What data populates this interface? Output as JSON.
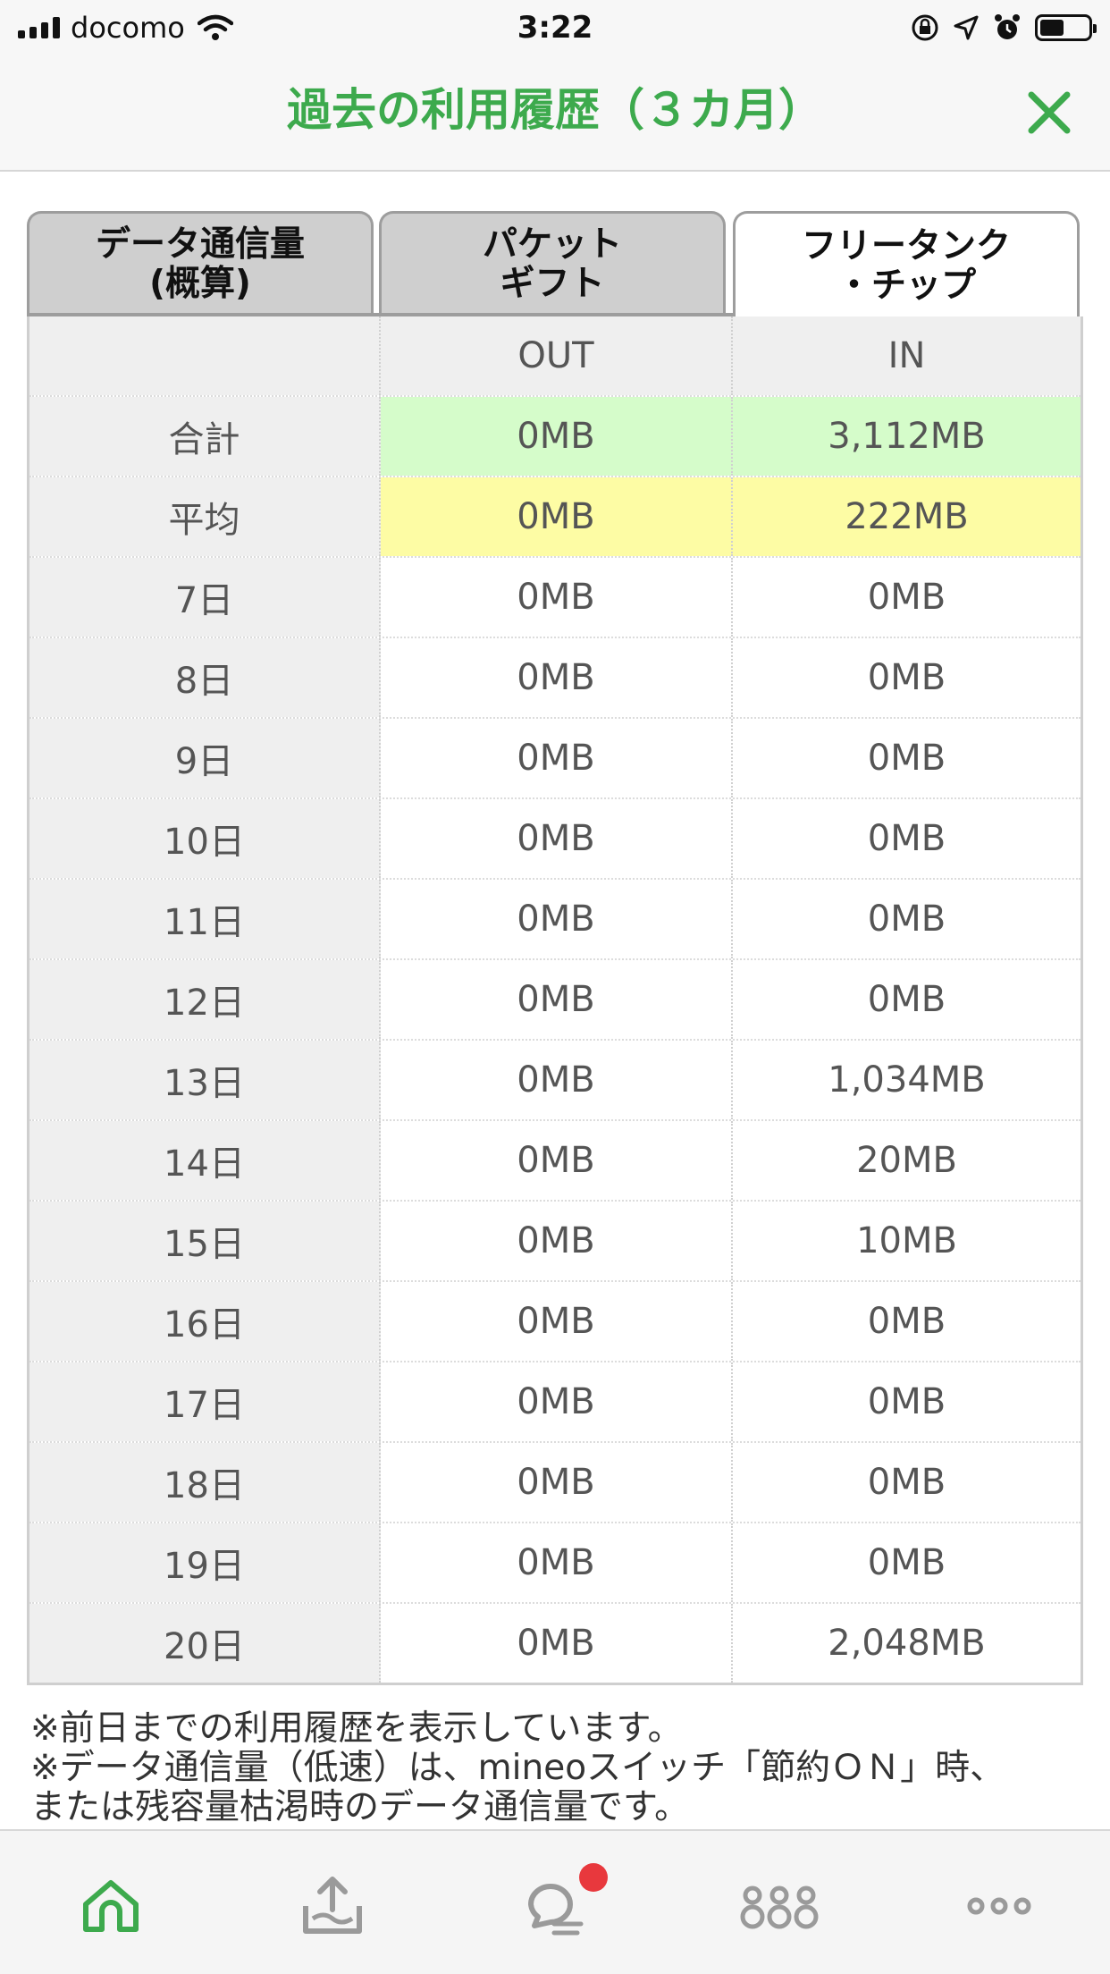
{
  "status_bar": {
    "carrier": "docomo",
    "time": "3:22"
  },
  "header": {
    "title": "過去の利用履歴（３カ月）"
  },
  "tabs": [
    {
      "label": "データ通信量\n(概算)",
      "active": false
    },
    {
      "label": "パケット\nギフト",
      "active": false
    },
    {
      "label": "フリータンク\n・チップ",
      "active": true
    }
  ],
  "table": {
    "header": {
      "label": "",
      "out": "OUT",
      "in": "IN"
    },
    "total": {
      "label": "合計",
      "out": "0MB",
      "in": "3,112MB"
    },
    "average": {
      "label": "平均",
      "out": "0MB",
      "in": "222MB"
    },
    "rows": [
      {
        "day": "7日",
        "out": "0MB",
        "in": "0MB"
      },
      {
        "day": "8日",
        "out": "0MB",
        "in": "0MB"
      },
      {
        "day": "9日",
        "out": "0MB",
        "in": "0MB"
      },
      {
        "day": "10日",
        "out": "0MB",
        "in": "0MB"
      },
      {
        "day": "11日",
        "out": "0MB",
        "in": "0MB"
      },
      {
        "day": "12日",
        "out": "0MB",
        "in": "0MB"
      },
      {
        "day": "13日",
        "out": "0MB",
        "in": "1,034MB"
      },
      {
        "day": "14日",
        "out": "0MB",
        "in": "20MB"
      },
      {
        "day": "15日",
        "out": "0MB",
        "in": "10MB"
      },
      {
        "day": "16日",
        "out": "0MB",
        "in": "0MB"
      },
      {
        "day": "17日",
        "out": "0MB",
        "in": "0MB"
      },
      {
        "day": "18日",
        "out": "0MB",
        "in": "0MB"
      },
      {
        "day": "19日",
        "out": "0MB",
        "in": "0MB"
      },
      {
        "day": "20日",
        "out": "0MB",
        "in": "2,048MB"
      }
    ]
  },
  "notes": [
    "※前日までの利用履歴を表示しています。",
    "※データ通信量（低速）は、mineoスイッチ「節約ＯＮ」時、",
    "または残容量枯渇時のデータ通信量です。"
  ],
  "bottom_nav": [
    {
      "icon": "home-icon",
      "active": true
    },
    {
      "icon": "packet-upload-icon",
      "active": false
    },
    {
      "icon": "chat-icon",
      "active": false,
      "badge": true
    },
    {
      "icon": "community-icon",
      "active": false
    },
    {
      "icon": "more-icon",
      "active": false
    }
  ],
  "colors": {
    "accent": "#3daa4d",
    "total_row": "#d5fcca",
    "average_row": "#fdfca4",
    "badge": "#e8383d"
  }
}
